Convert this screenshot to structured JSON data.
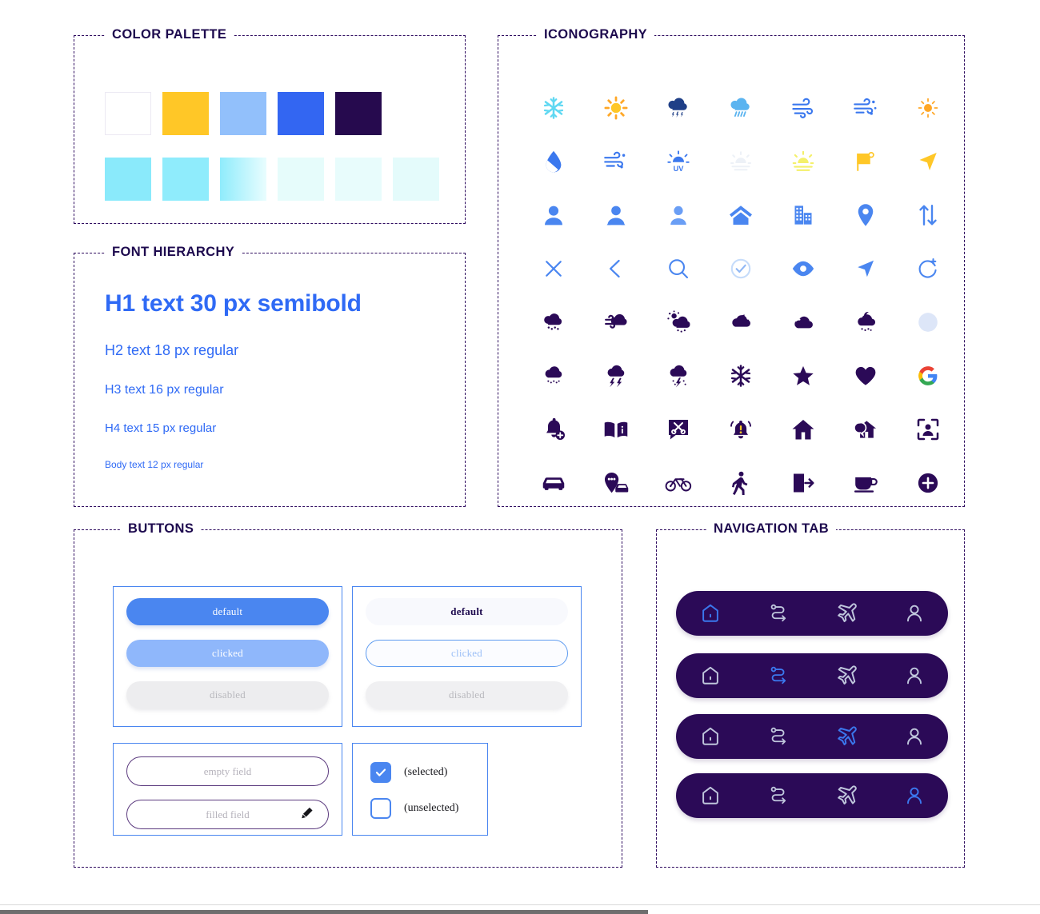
{
  "sections": {
    "color_palette": {
      "title": "COLOR PALETTE"
    },
    "font_hierarchy": {
      "title": "FONT HIERARCHY"
    },
    "iconography": {
      "title": "ICONOGRAPHY"
    },
    "buttons": {
      "title": "BUTTONS"
    },
    "navigation_tab": {
      "title": "NAVIGATION TAB"
    }
  },
  "color_palette": {
    "row1": [
      {
        "name": "white",
        "hex": "#FFFFFF"
      },
      {
        "name": "yellow",
        "hex": "#FFC727"
      },
      {
        "name": "light-blue",
        "hex": "#92C0FB"
      },
      {
        "name": "primary-blue",
        "hex": "#3366F2"
      },
      {
        "name": "deep-purple",
        "hex": "#260A4E"
      }
    ],
    "row2": [
      {
        "name": "cyan-100",
        "hex": "#8AEAFB"
      },
      {
        "name": "cyan-90",
        "hex": "#8FECFC"
      },
      {
        "name": "cyan-gradient",
        "hex": "#8FECFC",
        "hex2": "#E6FCFF"
      },
      {
        "name": "cyan-tint-30",
        "hex": "#E6FCFB"
      },
      {
        "name": "cyan-tint-20",
        "hex": "#E8FCFC"
      },
      {
        "name": "cyan-tint-10",
        "hex": "#E4FBFB"
      }
    ]
  },
  "font_hierarchy": {
    "color": "#2F6AF5",
    "items": [
      {
        "key": "h1",
        "text": "H1 text 30 px semibold"
      },
      {
        "key": "h2",
        "text": "H2 text 18 px regular"
      },
      {
        "key": "h3",
        "text": "H3 text 16 px regular"
      },
      {
        "key": "h4",
        "text": "H4 text 15 px regular"
      },
      {
        "key": "body",
        "text": "Body text 12 px regular"
      }
    ]
  },
  "iconography": {
    "rows": [
      [
        "snowflake-icon",
        "sun-icon",
        "thunderstorm-cloud-icon",
        "rain-cloud-icon",
        "wind-icon",
        "wind-snow-icon",
        "sun-small-icon"
      ],
      [
        "water-drop-icon",
        "wind-dust-icon",
        "uv-index-icon",
        "fog-sunrise-icon",
        "sunset-icon",
        "flag-icon",
        "navigation-arrow-icon"
      ],
      [
        "user-male-icon",
        "user-female-icon",
        "user-person-icon",
        "home-icon",
        "office-building-icon",
        "map-pin-icon",
        "sort-arrows-icon"
      ],
      [
        "close-icon",
        "chevron-left-icon",
        "search-icon",
        "check-circle-icon",
        "eye-icon",
        "send-arrow-icon",
        "refresh-plus-icon"
      ],
      [
        "cloud-snow-icon",
        "cloud-wind-icon",
        "sun-cloud-snow-icon",
        "moon-cloud-icon",
        "cloud-icon",
        "cloud-night-rain-icon",
        "full-moon-icon"
      ],
      [
        "cloud-hail-icon",
        "cloud-lightning-icon",
        "cloud-storm-rain-icon",
        "snowflake-dark-icon",
        "star-icon",
        "heart-icon",
        "google-icon"
      ],
      [
        "bell-add-icon",
        "book-info-icon",
        "scissors-tag-icon",
        "alert-bell-icon",
        "house-icon",
        "home-chat-icon",
        "face-scan-icon"
      ],
      [
        "car-icon",
        "car-pin-icon",
        "bicycle-icon",
        "pedestrian-icon",
        "logout-icon",
        "coffee-cup-icon",
        "plus-circle-icon"
      ]
    ],
    "colors": {
      "cyan": "#5FD8F2",
      "yellow": "#FFC727",
      "navy": "#1F3F87",
      "sky": "#5BB4F0",
      "blue": "#3B78EE",
      "light_blue": "#6A9EF5",
      "pale_yellow": "#F4F06A",
      "fog": "#E9EEF5",
      "purple": "#2B0A57",
      "moon": "#DDE6F8"
    }
  },
  "buttons": {
    "filled_group": [
      {
        "name": "default",
        "label": "default"
      },
      {
        "name": "clicked",
        "label": "clicked"
      },
      {
        "name": "disabled",
        "label": "disabled"
      }
    ],
    "ghost_group": [
      {
        "name": "default",
        "label": "default"
      },
      {
        "name": "clicked",
        "label": "clicked"
      },
      {
        "name": "disabled",
        "label": "disabled"
      }
    ],
    "fields": [
      {
        "name": "empty-field",
        "placeholder": "empty field",
        "value": ""
      },
      {
        "name": "filled-field",
        "placeholder": "filled field",
        "value": "filled field"
      }
    ],
    "checkboxes": [
      {
        "name": "selected",
        "label": "(selected)",
        "checked": true
      },
      {
        "name": "unselected",
        "label": "(unselected)",
        "checked": false
      }
    ]
  },
  "navigation_tab": {
    "bar_color": "#2B0A57",
    "active_color": "#3B78EE",
    "inactive_color": "#BFC6DC",
    "bars": [
      {
        "active_index": 0,
        "items": [
          "home-outline-icon",
          "route-outline-icon",
          "plane-outline-icon",
          "person-outline-icon"
        ]
      },
      {
        "active_index": 1,
        "items": [
          "home-outline-icon",
          "route-outline-icon",
          "plane-outline-icon",
          "person-outline-icon"
        ]
      },
      {
        "active_index": 2,
        "items": [
          "home-outline-icon",
          "route-outline-icon",
          "plane-outline-icon",
          "person-outline-icon"
        ]
      },
      {
        "active_index": 3,
        "items": [
          "home-outline-icon",
          "route-outline-icon",
          "plane-outline-icon",
          "person-outline-icon"
        ]
      }
    ]
  }
}
